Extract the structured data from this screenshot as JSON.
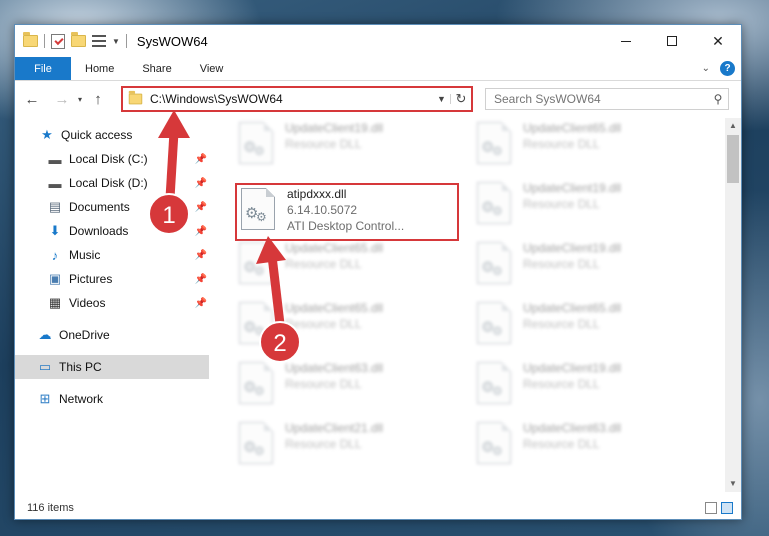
{
  "window": {
    "title": "SysWOW64"
  },
  "ribbon": {
    "tabs": [
      "File",
      "Home",
      "Share",
      "View"
    ],
    "help": "?"
  },
  "nav": {
    "back": "←",
    "forward": "→",
    "recent": "▾",
    "up": "↑",
    "address": "C:\\Windows\\SysWOW64",
    "search_placeholder": "Search SysWOW64"
  },
  "sidebar": {
    "items": [
      {
        "label": "Quick access",
        "icon": "star-icon",
        "glyph": "★",
        "color": "#1979ca",
        "pinned": false
      },
      {
        "label": "Local Disk (C:)",
        "icon": "drive-icon",
        "glyph": "▬",
        "color": "#555555",
        "pinned": true
      },
      {
        "label": "Local Disk (D:)",
        "icon": "drive-icon",
        "glyph": "▬",
        "color": "#555555",
        "pinned": true
      },
      {
        "label": "Documents",
        "icon": "documents-icon",
        "glyph": "▤",
        "color": "#5a6b7c",
        "pinned": true
      },
      {
        "label": "Downloads",
        "icon": "download-icon",
        "glyph": "⬇",
        "color": "#1979ca",
        "pinned": true
      },
      {
        "label": "Music",
        "icon": "music-icon",
        "glyph": "♪",
        "color": "#1979ca",
        "pinned": true
      },
      {
        "label": "Pictures",
        "icon": "pictures-icon",
        "glyph": "▣",
        "color": "#4a7db0",
        "pinned": true
      },
      {
        "label": "Videos",
        "icon": "videos-icon",
        "glyph": "▦",
        "color": "#333333",
        "pinned": true
      },
      {
        "label": "OneDrive",
        "icon": "cloud-icon",
        "glyph": "☁",
        "color": "#1979ca",
        "pinned": false
      },
      {
        "label": "This PC",
        "icon": "monitor-icon",
        "glyph": "▭",
        "color": "#2a7bc4",
        "pinned": false,
        "selected": true
      },
      {
        "label": "Network",
        "icon": "network-icon",
        "glyph": "⊞",
        "color": "#2a7bc4",
        "pinned": false
      }
    ]
  },
  "files": [
    {
      "name": "UpdateClient19.dll",
      "desc": "Resource DLL",
      "blur": true
    },
    {
      "name": "UpdateClient65.dll",
      "desc": "Resource DLL",
      "blur": true
    },
    {
      "name": "atipdxxx.dll",
      "desc": "6.14.10.5072",
      "desc2": "ATI Desktop Control...",
      "blur": false
    },
    {
      "name": "UpdateClient19.dll",
      "desc": "Resource DLL",
      "blur": true
    },
    {
      "name": "UpdateClient65.dll",
      "desc": "Resource DLL",
      "blur": true
    },
    {
      "name": "UpdateClient19.dll",
      "desc": "Resource DLL",
      "blur": true
    },
    {
      "name": "UpdateClient65.dll",
      "desc": "Resource DLL",
      "blur": true
    },
    {
      "name": "UpdateClient65.dll",
      "desc": "Resource DLL",
      "blur": true
    },
    {
      "name": "UpdateClient63.dll",
      "desc": "Resource DLL",
      "blur": true
    },
    {
      "name": "UpdateClient19.dll",
      "desc": "Resource DLL",
      "blur": true
    },
    {
      "name": "UpdateClient21.dll",
      "desc": "Resource DLL",
      "blur": true
    },
    {
      "name": "UpdateClient63.dll",
      "desc": "Resource DLL",
      "blur": true
    }
  ],
  "status": {
    "count": "116 items"
  },
  "annotations": {
    "step1": "1",
    "step2": "2",
    "color": "#d6383a"
  }
}
